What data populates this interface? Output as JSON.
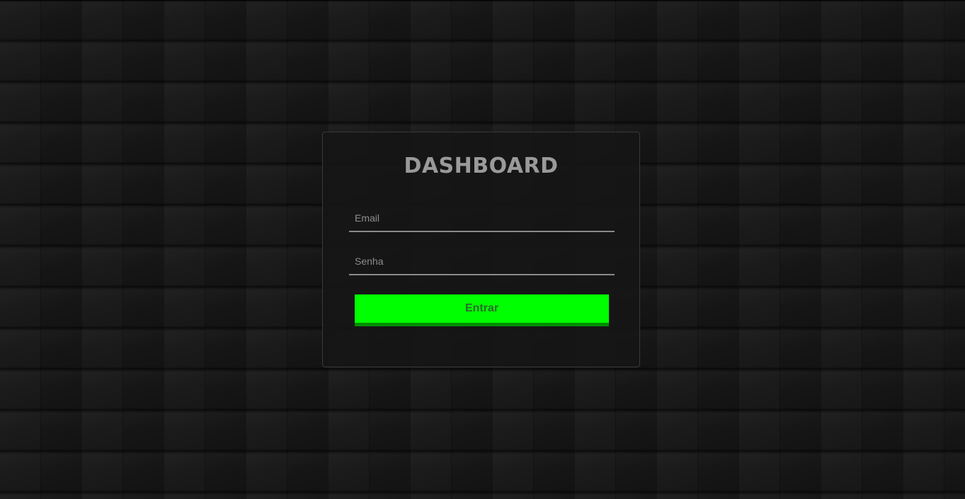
{
  "login": {
    "title": "DASHBOARD",
    "email": {
      "placeholder": "Email",
      "value": ""
    },
    "password": {
      "placeholder": "Senha",
      "value": ""
    },
    "submit_label": "Entrar"
  },
  "colors": {
    "accent": "#00ff00",
    "accent_shadow": "#008f00",
    "background": "#141414",
    "title": "#9a9a9a"
  }
}
